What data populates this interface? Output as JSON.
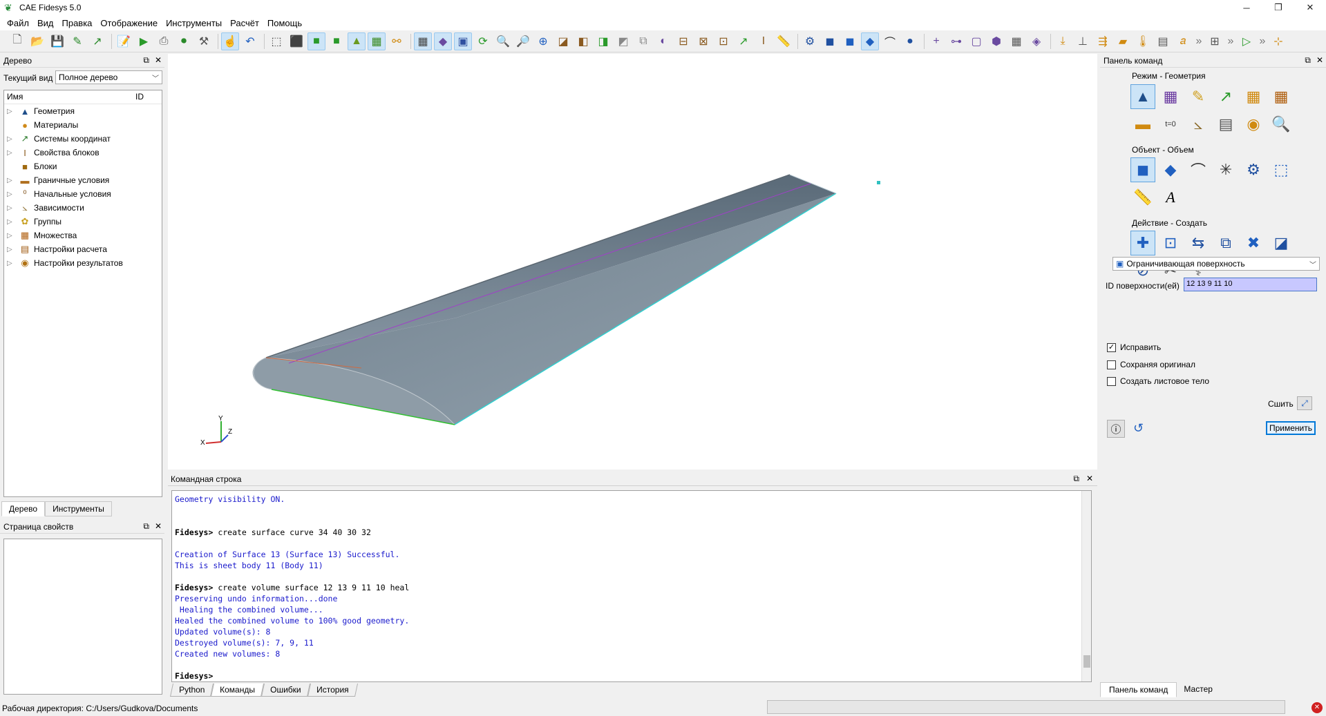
{
  "window": {
    "title": "CAE Fidesys 5.0",
    "minimize": "─",
    "restore": "❐",
    "close": "✕"
  },
  "menu": [
    "Файл",
    "Вид",
    "Правка",
    "Отображение",
    "Инструменты",
    "Расчёт",
    "Помощь"
  ],
  "left": {
    "tree_title": "Дерево",
    "current_view_label": "Текущий вид",
    "current_view_value": "Полное дерево",
    "col_name": "Имя",
    "col_id": "ID",
    "items": [
      {
        "label": "Геометрия",
        "icon": "geometry-icon",
        "glyph": "▲",
        "color": "#1f4e8a"
      },
      {
        "label": "Материалы",
        "icon": "materials-icon",
        "glyph": "●",
        "color": "#d08a1a"
      },
      {
        "label": "Системы координат",
        "icon": "coordinate-systems-icon",
        "glyph": "↗",
        "color": "#2a7a2a"
      },
      {
        "label": "Свойства блоков",
        "icon": "block-properties-icon",
        "glyph": "I",
        "color": "#8a5a1a"
      },
      {
        "label": "Блоки",
        "icon": "blocks-icon",
        "glyph": "■",
        "color": "#a06a10"
      },
      {
        "label": "Граничные условия",
        "icon": "boundary-conditions-icon",
        "glyph": "▬",
        "color": "#b07020"
      },
      {
        "label": "Начальные условия",
        "icon": "initial-conditions-icon",
        "glyph": "⁰",
        "color": "#7a4a10"
      },
      {
        "label": "Зависимости",
        "icon": "dependencies-icon",
        "glyph": "⦣",
        "color": "#8a6a2a"
      },
      {
        "label": "Группы",
        "icon": "groups-icon",
        "glyph": "✿",
        "color": "#c8a020"
      },
      {
        "label": "Множества",
        "icon": "sets-icon",
        "glyph": "▦",
        "color": "#b06010"
      },
      {
        "label": "Настройки расчета",
        "icon": "calc-settings-icon",
        "glyph": "▤",
        "color": "#a05a10"
      },
      {
        "label": "Настройки результатов",
        "icon": "results-settings-icon",
        "glyph": "◉",
        "color": "#b07010"
      }
    ],
    "tabs": [
      "Дерево",
      "Инструменты"
    ],
    "props_title": "Страница свойств"
  },
  "command_line": {
    "title": "Командная строка",
    "lines": [
      {
        "t": "Geometry visibility ON.",
        "c": "blue"
      },
      {
        "t": "",
        "c": "blkn"
      },
      {
        "t": "",
        "c": "blkn"
      },
      {
        "t": "Fidesys> create surface curve 34 40 30 32",
        "c": "prompt"
      },
      {
        "t": "",
        "c": "blkn"
      },
      {
        "t": "Creation of Surface 13 (Surface 13) Successful.",
        "c": "blue"
      },
      {
        "t": "This is sheet body 11 (Body 11)",
        "c": "blue"
      },
      {
        "t": "",
        "c": "blkn"
      },
      {
        "t": "Fidesys> create volume surface 12 13 9 11 10 heal",
        "c": "prompt"
      },
      {
        "t": "Preserving undo information...done",
        "c": "blue"
      },
      {
        "t": " Healing the combined volume...",
        "c": "blue"
      },
      {
        "t": "Healed the combined volume to 100% good geometry.",
        "c": "blue"
      },
      {
        "t": "Updated volume(s): 8",
        "c": "blue"
      },
      {
        "t": "Destroyed volume(s): 7, 9, 11",
        "c": "blue"
      },
      {
        "t": "Created new volumes: 8",
        "c": "blue"
      },
      {
        "t": "",
        "c": "blkn"
      },
      {
        "t": "Fidesys>",
        "c": "prompt"
      }
    ],
    "tabs": [
      "Python",
      "Команды",
      "Ошибки",
      "История"
    ]
  },
  "right": {
    "title": "Панель команд",
    "mode_label": "Режим - Геометрия",
    "object_label": "Объект - Объем",
    "action_label": "Действие - Создать",
    "dropdown_value": "Ограничивающая поверхность",
    "surface_ids_label": "ID поверхности(ей)",
    "surface_ids_value": "12 13 9 11 10",
    "check_heal": "Исправить",
    "check_keep": "Сохраняя оригинал",
    "check_sheet": "Создать листовое тело",
    "stitch_label": "Сшить",
    "apply_label": "Применить",
    "tabs": [
      "Панель команд",
      "Мастер"
    ]
  },
  "status": {
    "workdir": "Рабочая директория: C:/Users/Gudkova/Documents"
  },
  "axes": {
    "x": "X",
    "y": "Y",
    "z": "Z"
  }
}
